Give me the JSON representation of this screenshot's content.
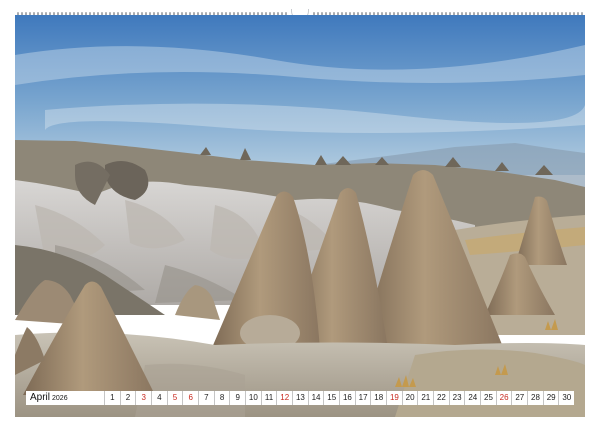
{
  "calendar": {
    "month": "April",
    "year": "2026",
    "days": [
      {
        "d": "1",
        "h": false
      },
      {
        "d": "2",
        "h": false
      },
      {
        "d": "3",
        "h": true
      },
      {
        "d": "4",
        "h": false
      },
      {
        "d": "5",
        "h": true
      },
      {
        "d": "6",
        "h": true
      },
      {
        "d": "7",
        "h": false
      },
      {
        "d": "8",
        "h": false
      },
      {
        "d": "9",
        "h": false
      },
      {
        "d": "10",
        "h": false
      },
      {
        "d": "11",
        "h": false
      },
      {
        "d": "12",
        "h": true
      },
      {
        "d": "13",
        "h": false
      },
      {
        "d": "14",
        "h": false
      },
      {
        "d": "15",
        "h": false
      },
      {
        "d": "16",
        "h": false
      },
      {
        "d": "17",
        "h": false
      },
      {
        "d": "18",
        "h": false
      },
      {
        "d": "19",
        "h": true
      },
      {
        "d": "20",
        "h": false
      },
      {
        "d": "21",
        "h": false
      },
      {
        "d": "22",
        "h": false
      },
      {
        "d": "23",
        "h": false
      },
      {
        "d": "24",
        "h": false
      },
      {
        "d": "25",
        "h": false
      },
      {
        "d": "26",
        "h": true
      },
      {
        "d": "27",
        "h": false
      },
      {
        "d": "28",
        "h": false
      },
      {
        "d": "29",
        "h": false
      },
      {
        "d": "30",
        "h": false
      }
    ],
    "holiday_color": "#c8281e"
  },
  "photo": {
    "subject": "fairy-chimney-rock-landscape",
    "sky_top_color": "#3f79bd",
    "sky_bottom_color": "#a9c6dc",
    "rock_color": "#a08a70"
  }
}
